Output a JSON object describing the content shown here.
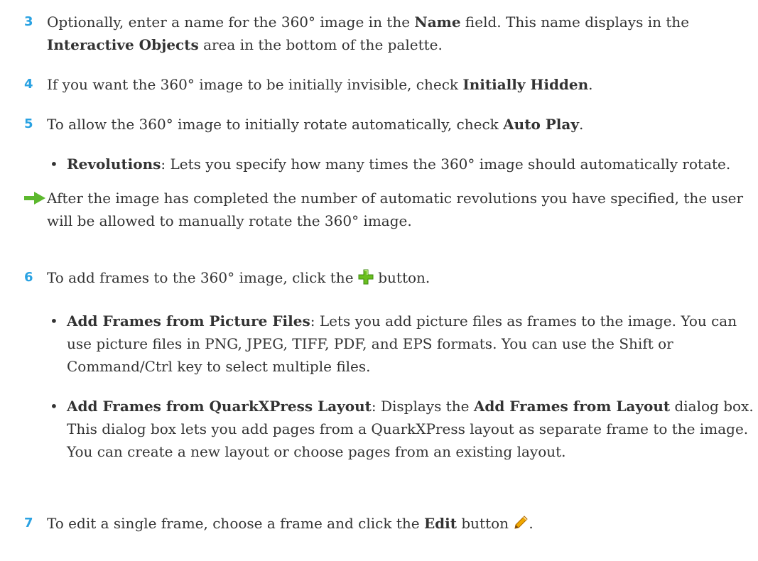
{
  "steps": [
    {
      "number": "3",
      "parts": {
        "t1": "Optionally, enter a name for the 360° image in the ",
        "b1": "Name",
        "t2": " field. This name displays in the ",
        "b2": "Interactive Objects",
        "t3": " area in the bottom of the palette."
      }
    },
    {
      "number": "4",
      "parts": {
        "t1": "If you want the 360° image to be initially invisible, check ",
        "b1": "Initially Hidden",
        "t2": "."
      }
    },
    {
      "number": "5",
      "parts": {
        "t1": "To allow the 360° image to initially rotate automatically, check ",
        "b1": "Auto Play",
        "t2": "."
      }
    },
    {
      "number": "6",
      "parts": {
        "t1": "To add frames to the 360° image, click the ",
        "t2": " button."
      }
    },
    {
      "number": "7",
      "parts": {
        "t1": "To edit a single frame, choose a frame and click the ",
        "b1": "Edit",
        "t2": " button ",
        "t3": "."
      }
    }
  ],
  "bullets": {
    "revolutions": {
      "bullet": "•",
      "term": "Revolutions",
      "text": ": Lets you specify how many times the 360° image should automatically rotate."
    },
    "picture_files": {
      "bullet": "•",
      "term": "Add Frames from Picture Files",
      "text": ": Lets you add picture files as frames to the image. You can use picture files in PNG, JPEG, TIFF, PDF, and EPS formats. You can use the Shift or Command/Ctrl key to select multiple files."
    },
    "quark_layout": {
      "bullet": "•",
      "term": "Add Frames from QuarkXPress Layout",
      "t1": ": Displays the ",
      "b1": "Add Frames from Layout",
      "t2": " dialog box. This dialog box lets you add pages from a QuarkXPress layout as separate frame to the image. You can create a new layout or choose pages from an existing layout."
    }
  },
  "note": {
    "icon": "green-arrow-icon",
    "text": "After the image has completed the number of automatic revolutions you have specified, the user will be allowed to manually rotate the 360° image."
  },
  "colors": {
    "step_number": "#2aa2e2",
    "body_text": "#333333",
    "note_arrow": "#5cb82e",
    "plus_icon": "#6abf1f",
    "pencil_icon": "#f0a800"
  },
  "icons": {
    "add_button": "plus-icon",
    "edit_button": "pencil-icon"
  }
}
